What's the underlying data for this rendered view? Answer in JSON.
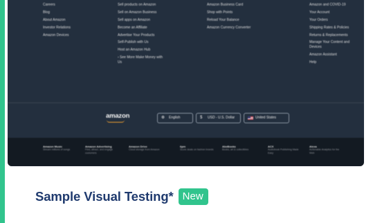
{
  "card": {
    "title": "Sample Visual Testing*",
    "badge": "New",
    "accent_color": "#31c48d",
    "title_color": "#1f3a6e"
  },
  "preview": {
    "footer": {
      "col1": [
        "Careers",
        "Blog",
        "About Amazon",
        "Investor Relations",
        "Amazon Devices"
      ],
      "col2": [
        "Sell products on Amazon",
        "Sell on Amazon Business",
        "Sell apps on Amazon",
        "Become an Affiliate",
        "Advertise Your Products",
        "Self-Publish with Us",
        "Host an Amazon Hub",
        "› See More Make Money with Us"
      ],
      "col3": [
        "Amazon Business Card",
        "Shop with Points",
        "Reload Your Balance",
        "Amazon Currency Converter"
      ],
      "col4": [
        "Amazon and COVID-19",
        "Your Account",
        "Your Orders",
        "Shipping Rates & Policies",
        "Returns & Replacements",
        "Manage Your Content and Devices",
        "Amazon Assistant",
        "Help"
      ]
    },
    "logo": "amazon",
    "language": "English",
    "currency": "USD - U.S. Dollar",
    "country": "United States",
    "services": [
      {
        "title": "Amazon Music",
        "desc": "Stream millions of songs"
      },
      {
        "title": "Amazon Advertising",
        "desc": "Find, attract, and engage customers"
      },
      {
        "title": "Amazon Drive",
        "desc": "Cloud storage from Amazon"
      },
      {
        "title": "6pm",
        "desc": "Score deals on fashion brands"
      },
      {
        "title": "AbeBooks",
        "desc": "Books, art & collectibles"
      },
      {
        "title": "ACX",
        "desc": "Audiobook Publishing Made Easy"
      },
      {
        "title": "Alexa",
        "desc": "Actionable Analytics for the Web"
      }
    ],
    "colors": {
      "footer_bg": "#232f3e",
      "band_bg": "#131a22",
      "smile": "#f0a030"
    },
    "icons": {
      "language": "globe-icon",
      "currency": "dollar-icon",
      "country": "flag-icon"
    }
  }
}
